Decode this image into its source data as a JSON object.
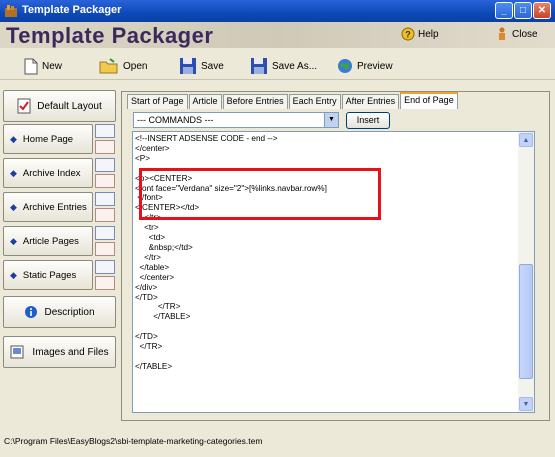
{
  "window": {
    "title": "Template Packager",
    "min": "_",
    "max": "□",
    "close": "✕"
  },
  "header": {
    "app_title": "Template Packager",
    "help": "Help",
    "close": "Close"
  },
  "toolbar": {
    "new": "New",
    "open": "Open",
    "save": "Save",
    "save_as": "Save As...",
    "preview": "Preview"
  },
  "sidebar": {
    "default_layout": "Default Layout",
    "items": [
      "Home Page",
      "Archive Index",
      "Archive Entries",
      "Article Pages",
      "Static Pages"
    ],
    "description": "Description",
    "images": "Images and Files"
  },
  "tabs": [
    "Start of Page",
    "Article",
    "Before Entries",
    "Each Entry",
    "After Entries",
    "End of Page"
  ],
  "commands": {
    "value": "--- COMMANDS ---",
    "insert": "Insert"
  },
  "code_lines": [
    "<!--INSERT ADSENSE CODE - end -->",
    "</center>",
    "<P>",
    "",
    "<p><CENTER>",
    "<font face=\"Verdana\" size=\"2\">[%links.navbar.row%]",
    " </font>",
    "</CENTER></td>",
    "    </tr>",
    "    <tr>",
    "      <td>",
    "      &nbsp;</td>",
    "    </tr>",
    "  </table>",
    "  </center>",
    "</div>",
    "</TD>",
    "          </TR>",
    "        </TABLE>",
    "",
    "</TD>",
    "  </TR>",
    "",
    "</TABLE>"
  ],
  "status": "C:\\Program Files\\EasyBlogs2\\sbi-template-marketing-categories.tem"
}
